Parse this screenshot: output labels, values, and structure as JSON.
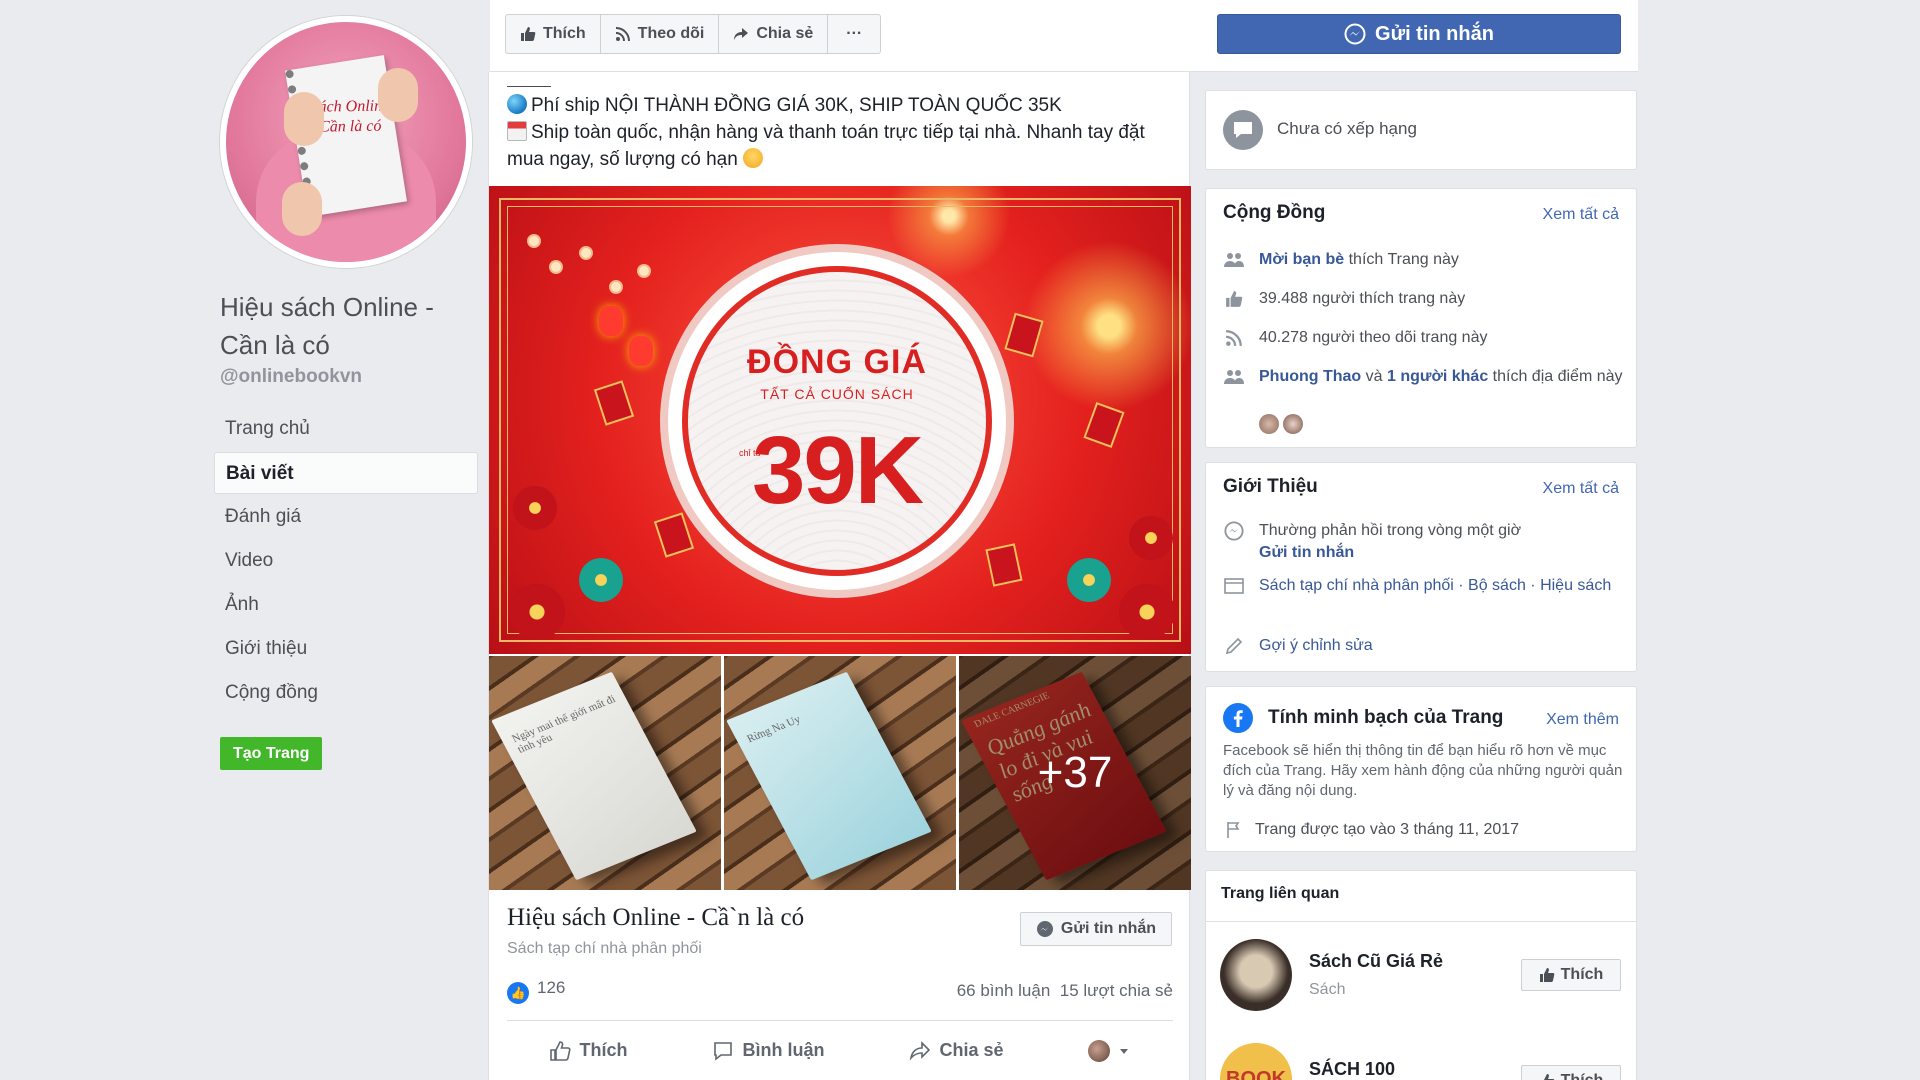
{
  "colors": {
    "accent": "#4267b2",
    "link": "#385898",
    "create_page": "#42b72a",
    "background": "#e9ebee"
  },
  "page": {
    "name": "Hiệu sách Online - Cần là có",
    "handle": "@onlinebookvn",
    "avatar_text": "Sách Online Cần là có",
    "create_page": "Tạo Trang"
  },
  "nav": [
    {
      "label": "Trang chủ",
      "active": false
    },
    {
      "label": "Bài viết",
      "active": true
    },
    {
      "label": "Đánh giá",
      "active": false
    },
    {
      "label": "Video",
      "active": false
    },
    {
      "label": "Ảnh",
      "active": false
    },
    {
      "label": "Giới thiệu",
      "active": false
    },
    {
      "label": "Cộng đồng",
      "active": false
    }
  ],
  "toolbar": {
    "like": "Thích",
    "follow": "Theo dõi",
    "share": "Chia sẻ",
    "more": "···",
    "send_message": "Gửi tin nhắn"
  },
  "post": {
    "line1": "Phí ship NỘI THÀNH ĐỒNG GIÁ 30K, SHIP TOÀN QUỐC 35K",
    "line2": "Ship toàn quốc, nhận hàng và thanh toán trực tiếp tại nhà. Nhanh tay đặt mua ngay, số lượng có hạn",
    "hero": {
      "title": "ĐỒNG GIÁ",
      "subtitle": "TẤT CẢ CUỐN SÁCH",
      "chi": "chỉ từ",
      "price": "39K"
    },
    "books": [
      {
        "cover_text": "Ngày mai thế giới mất đi tình yêu"
      },
      {
        "cover_text": "Rừng Na Uy"
      },
      {
        "cover_text": "Quẳng gánh lo đi và vui sống"
      }
    ],
    "more_photos": "+37",
    "author_label": "DALE CARNEGIE",
    "link_title": "Hiệu sách Online - Cầ`n là có",
    "link_subtitle": "Sách tạp chí nhà phân phối",
    "link_button": "Gửi tin nhắn",
    "reactions": "126",
    "comments": "66 bình luận",
    "shares": "15 lượt chia sẻ",
    "action_like": "Thích",
    "action_comment": "Bình luận",
    "action_share": "Chia sẻ"
  },
  "rating": {
    "text": "Chưa có xếp hạng"
  },
  "community": {
    "title": "Cộng Đồng",
    "see_all": "Xem tất cả",
    "invite_link": "Mời bạn bè",
    "invite_rest": " thích Trang này",
    "likes": "39.488 người thích trang này",
    "followers": "40.278 người theo dõi trang này",
    "friend_name": "Phuong Thao",
    "friend_and": " và ",
    "friend_others": "1 người khác",
    "friend_rest": " thích địa điểm này"
  },
  "about": {
    "title": "Giới Thiệu",
    "see_all": "Xem tất cả",
    "response": "Thường phản hồi trong vòng một giờ",
    "send_message": "Gửi tin nhắn",
    "categories": "Sách tạp chí nhà phân phối · Bộ sách · Hiệu sách",
    "suggest_edit": "Gợi ý chỉnh sửa"
  },
  "transparency": {
    "title": "Tính minh bạch của Trang",
    "see_more": "Xem thêm",
    "description": "Facebook sẽ hiển thị thông tin để bạn hiểu rõ hơn về mục đích của Trang. Hãy xem hành động của những người quản lý và đăng nội dung.",
    "created": "Trang được tạo vào 3 tháng 11, 2017"
  },
  "related": {
    "title": "Trang liên quan",
    "items": [
      {
        "name": "Sách Cũ Giá Rẻ",
        "category": "Sách",
        "like": "Thích"
      },
      {
        "name": "SÁCH 100",
        "category": "",
        "like": "Thích",
        "avatar_text": "BOOK"
      }
    ]
  }
}
